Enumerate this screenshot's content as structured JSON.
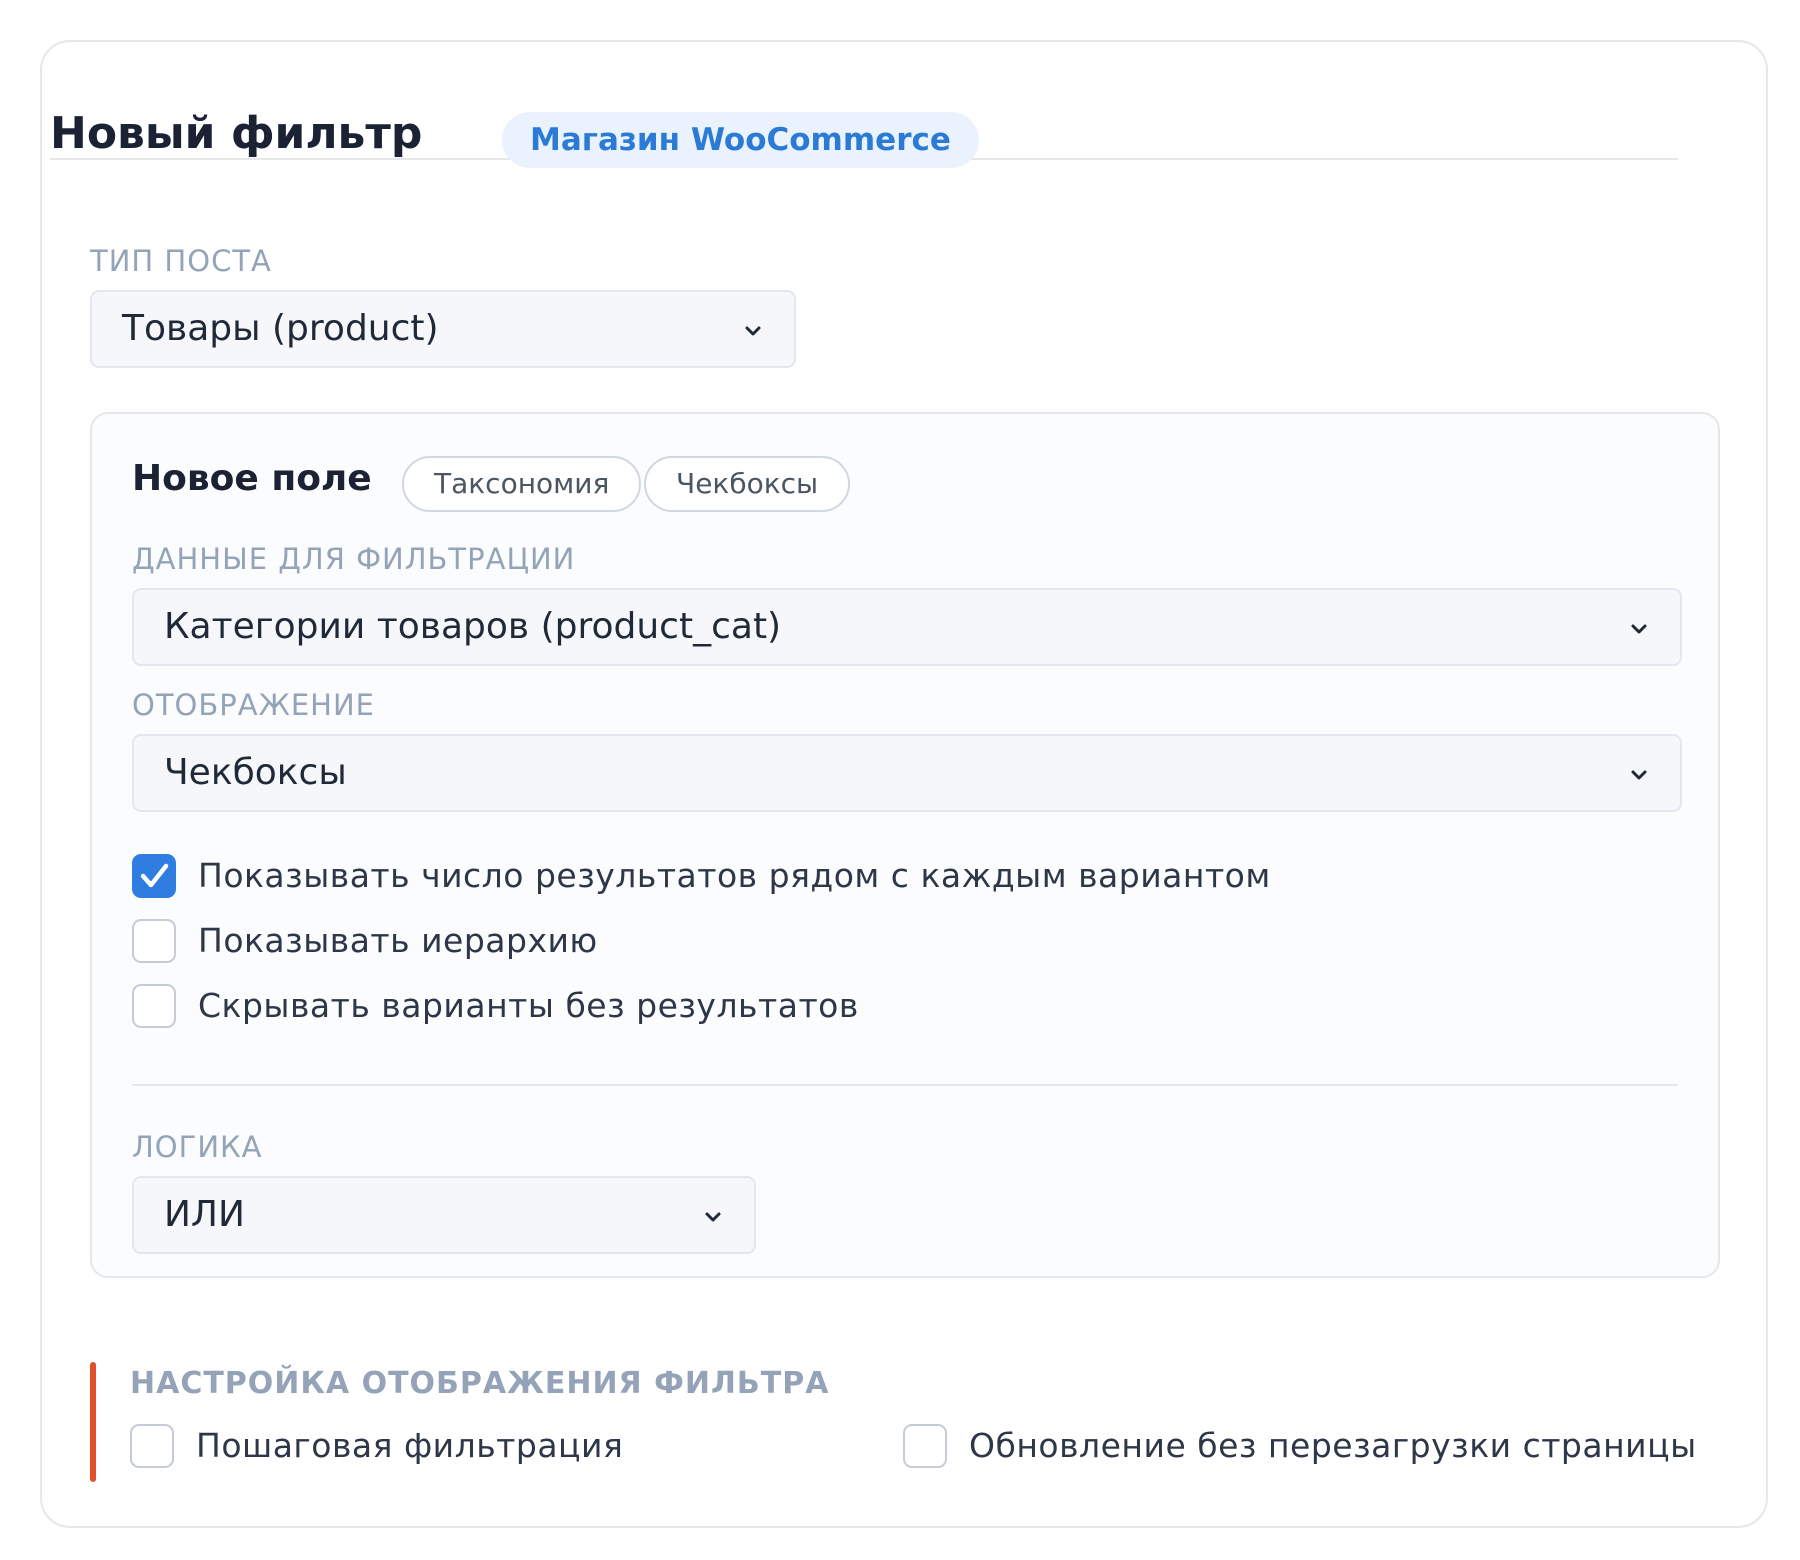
{
  "header": {
    "title": "Новый фильтр",
    "badge": "Магазин WooCommerce"
  },
  "post_type": {
    "label": "ТИП ПОСТА",
    "value": "Товары (product)"
  },
  "field": {
    "title": "Новое поле",
    "chips": [
      "Таксономия",
      "Чекбоксы"
    ],
    "data_label": "ДАННЫЕ ДЛЯ ФИЛЬТРАЦИИ",
    "data_value": "Категории товаров (product_cat)",
    "display_label": "ОТОБРАЖЕНИЕ",
    "display_value": "Чекбоксы",
    "options": [
      {
        "label": "Показывать число результатов рядом с каждым вариантом",
        "checked": true
      },
      {
        "label": "Показывать иерархию",
        "checked": false
      },
      {
        "label": "Скрывать варианты без результатов",
        "checked": false
      }
    ],
    "logic_label": "ЛОГИКА",
    "logic_value": "ИЛИ"
  },
  "settings": {
    "title": "НАСТРОЙКА ОТОБРАЖЕНИЯ ФИЛЬТРА",
    "options": [
      {
        "label": "Пошаговая фильтрация",
        "checked": false
      },
      {
        "label": "Обновление без перезагрузки страницы",
        "checked": false
      }
    ]
  },
  "colors": {
    "accent": "#2f7de1",
    "badge_text": "#2b7bd6",
    "badge_bg": "#eaf2fd",
    "section_marker": "#e0502a"
  },
  "icons": {
    "select_arrow": "chevron-down-icon",
    "checked_mark": "checkmark-icon"
  }
}
